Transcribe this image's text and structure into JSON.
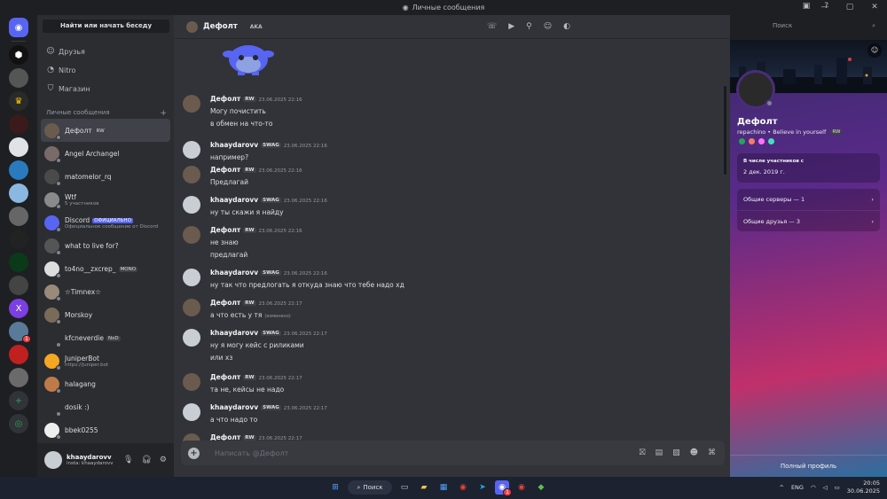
{
  "window": {
    "title": "Личные сообщения"
  },
  "sidebar": {
    "search_button": "Найти или начать беседу",
    "nav": [
      {
        "label": "Друзья",
        "icon": "friends-icon"
      },
      {
        "label": "Nitro",
        "icon": "nitro-icon"
      },
      {
        "label": "Магазин",
        "icon": "shop-icon"
      }
    ],
    "dm_header": "Личные сообщения",
    "dms": [
      {
        "name": "Дефолт",
        "tag": "RW",
        "sub": "",
        "active": true,
        "color": "#6b5b4e"
      },
      {
        "name": "Angel Archangel",
        "tag": "",
        "sub": "",
        "color": "#7a6a6a"
      },
      {
        "name": "matomelor_rq",
        "tag": "",
        "sub": "",
        "color": "#4a4a4a"
      },
      {
        "name": "Wtf",
        "tag": "",
        "sub": "5 участников",
        "color": "#8a8a8a"
      },
      {
        "name": "Discord",
        "tag": "ОФИЦИАЛЬНО",
        "tag_blue": true,
        "sub": "Официальное сообщение от Discord",
        "color": "#5865f2"
      },
      {
        "name": "what to live for?",
        "tag": "",
        "sub": "",
        "color": "#555"
      },
      {
        "name": "to4no__zxcrep_",
        "tag": "MONO",
        "sub": "",
        "color": "#ddd"
      },
      {
        "name": "☆Timnex☆",
        "tag": "",
        "sub": "",
        "color": "#9a8a7a"
      },
      {
        "name": "Morskoy",
        "tag": "",
        "sub": "",
        "color": "#7a6a5a"
      },
      {
        "name": "kfcneverdie",
        "tag": "NxD",
        "sub": "",
        "color": "#2b2d31"
      },
      {
        "name": "JuniperBot",
        "tag": "",
        "sub": "https://juniper.bot",
        "color": "#f5a623"
      },
      {
        "name": "halagang",
        "tag": "",
        "sub": "",
        "color": "#c07a4a"
      },
      {
        "name": "dosik :)",
        "tag": "",
        "sub": "",
        "color": "#2b2d31"
      },
      {
        "name": "bbek0255",
        "tag": "",
        "sub": "",
        "color": "#eee"
      }
    ]
  },
  "user": {
    "name": "khaaydarovv",
    "status": "insta: khaaydarovv"
  },
  "chat": {
    "title": "Дефолт",
    "aka": "AKA",
    "search_placeholder": "Поиск",
    "composer_placeholder": "Написать @Дефолт",
    "messages": [
      {
        "author": "Дефолт",
        "tag": "RW",
        "time": "23.06.2025 22:16",
        "lines": [
          "Могу почистить",
          "в обмен на что-то"
        ]
      },
      {
        "author": "khaaydarovv",
        "tag": "SWAG",
        "time": "23.06.2025 22:16",
        "lines": [
          "например?"
        ]
      },
      {
        "author": "Дефолт",
        "tag": "RW",
        "time": "23.06.2025 22:16",
        "lines": [
          "Предлагай"
        ]
      },
      {
        "author": "khaaydarovv",
        "tag": "SWAG",
        "time": "23.06.2025 22:16",
        "lines": [
          "ну ты скажи я найду"
        ]
      },
      {
        "author": "Дефолт",
        "tag": "RW",
        "time": "23.06.2025 22:16",
        "lines": [
          "не знаю",
          "предлагай"
        ]
      },
      {
        "author": "khaaydarovv",
        "tag": "SWAG",
        "time": "23.06.2025 22:16",
        "lines": [
          "ну так что предлогать я откуда знаю что тебе надо хд"
        ]
      },
      {
        "author": "Дефолт",
        "tag": "RW",
        "time": "23.06.2025 22:17",
        "lines": [
          "а что есть у тя"
        ],
        "edited": "(изменено)"
      },
      {
        "author": "khaaydarovv",
        "tag": "SWAG",
        "time": "23.06.2025 22:17",
        "lines": [
          "ну я могу кейс с риликами",
          "или хз"
        ]
      },
      {
        "author": "Дефолт",
        "tag": "RW",
        "time": "23.06.2025 22:17",
        "lines": [
          "та не, кейсы не надо"
        ]
      },
      {
        "author": "khaaydarovv",
        "tag": "SWAG",
        "time": "23.06.2025 22:17",
        "lines": [
          "а что надо то"
        ]
      },
      {
        "author": "Дефолт",
        "tag": "RW",
        "time": "23.06.2025 22:17",
        "lines": []
      }
    ]
  },
  "profile": {
    "name": "Дефолт",
    "username": "repachino",
    "bio": "Believe in yourself",
    "tag": "RW",
    "member_since_label": "В числе участников с",
    "member_since": "2 дек. 2019 г.",
    "mutual_servers": "Общие серверы — 1",
    "mutual_friends": "Общие друзья — 3",
    "full_profile": "Полный профиль"
  },
  "taskbar": {
    "search": "Поиск",
    "lang": "ENG",
    "time": "20:05",
    "date": "30.06.2025",
    "discord_badge": "1"
  }
}
